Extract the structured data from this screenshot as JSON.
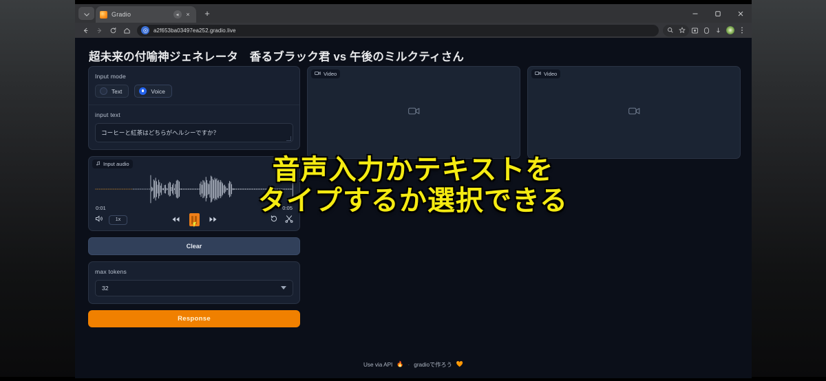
{
  "browser": {
    "tab": {
      "title": "Gradio",
      "favicon": "gradio-favicon",
      "audio_indicator": "speaker-icon",
      "close": "×"
    },
    "new_tab": "+",
    "window_controls": {
      "minimize": "–",
      "maximize": "⬜",
      "close": "✕"
    },
    "nav": {
      "back": "←",
      "forward": "→",
      "reload": "⟳",
      "home": "⌂"
    },
    "omnibox": {
      "badge": "⎈",
      "url": "a2f653ba03497ea252.gradio.live",
      "placeholder": "Search or type URL"
    },
    "toolbar_icons": [
      "zoom-icon",
      "bookmark-star-icon",
      "extension-puzzle-icon",
      "cast-icon",
      "download-icon",
      "profile-avatar",
      "chrome-menu-icon"
    ]
  },
  "app": {
    "title": "超未来の付喻神ジェネレータ　香るブラック君 vs 午後のミルクティさん",
    "input_mode": {
      "label": "Input mode",
      "options": [
        {
          "label": "Text",
          "selected": false
        },
        {
          "label": "Voice",
          "selected": true
        }
      ]
    },
    "input_text": {
      "label": "input text",
      "value": "コーヒーと紅茶はどちらがヘルシーですか？",
      "placeholder": ""
    },
    "input_audio": {
      "label": "Input audio",
      "icon": "music-note-icon",
      "close": "✕",
      "time_current": "0:01",
      "time_total": "0:05",
      "speed": "1x",
      "volume_icon": "volume-icon",
      "rewind_icon": "rewind-icon",
      "pause_icon": "pause-icon",
      "forward_icon": "fast-forward-icon",
      "undo_icon": "undo-icon",
      "trim_icon": "scissors-icon",
      "waveform": [
        2,
        2,
        2,
        2,
        2,
        2,
        2,
        2,
        2,
        2,
        2,
        2,
        2,
        2,
        2,
        2,
        2,
        2,
        2,
        2,
        2,
        2,
        2,
        2,
        2,
        2,
        2,
        2,
        2,
        2,
        2,
        2,
        2,
        2,
        2,
        2,
        2,
        2,
        2,
        2,
        2,
        2,
        2,
        2,
        2,
        2,
        2,
        2,
        2,
        2,
        2,
        2,
        2,
        2,
        2,
        2,
        96,
        16,
        10,
        66,
        58,
        78,
        54,
        30,
        64,
        48,
        24,
        40,
        6,
        6,
        28,
        30,
        8,
        4,
        40,
        50,
        46,
        14,
        30,
        40,
        6,
        34,
        58,
        64,
        60,
        52,
        4,
        4,
        3,
        3,
        3,
        3,
        3,
        3,
        3,
        3,
        3,
        3,
        3,
        3,
        3,
        3,
        3,
        3,
        3,
        3,
        38,
        52,
        30,
        62,
        58,
        46,
        84,
        62,
        40,
        34,
        58,
        92,
        86,
        70,
        62,
        78,
        68,
        74,
        58,
        64,
        48,
        62,
        50,
        40,
        26,
        30,
        18,
        6,
        5,
        40,
        56,
        50,
        34,
        6,
        5,
        4,
        3,
        3,
        3,
        3,
        3,
        3,
        3,
        3,
        3,
        3,
        3,
        3,
        3,
        3,
        3,
        3,
        3,
        3,
        3,
        3,
        3,
        3,
        3,
        3,
        3,
        3,
        3,
        3,
        3,
        3,
        3,
        3,
        3,
        3,
        3,
        3,
        3,
        3,
        3,
        3,
        3,
        3,
        3,
        3,
        3,
        3,
        3,
        3,
        3,
        3,
        3,
        3,
        3,
        3,
        3,
        3,
        3,
        3,
        84
      ],
      "played_fraction": 0.19
    },
    "clear_button": "Clear",
    "max_tokens": {
      "label": "max tokens",
      "value": "32",
      "caret": "▼"
    },
    "response_button": "Response",
    "videos": [
      {
        "label": "Video",
        "icon": "video-camera-icon",
        "placeholder_icon": "video-camera-icon"
      },
      {
        "label": "Video",
        "icon": "video-camera-icon",
        "placeholder_icon": "video-camera-icon"
      }
    ],
    "footer": {
      "use_via_api": "Use via API",
      "api_icon": "🔥",
      "separator": "·",
      "built_with": "gradioで作ろう",
      "heart_icon": "🧡"
    }
  },
  "overlay": {
    "subtitle_line1": "音声入力かテキストを",
    "subtitle_line2": "タイプするか選択できる"
  },
  "colors": {
    "accent_orange": "#f08000",
    "radio_blue": "#2563eb",
    "subtitle_yellow": "#f5eb12",
    "panel_bg": "#182030",
    "page_bg": "#0b0f19"
  }
}
